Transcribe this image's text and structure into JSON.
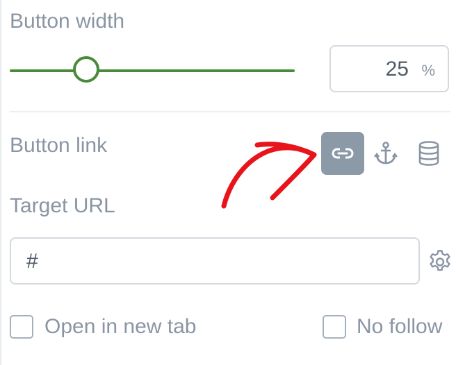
{
  "button_width": {
    "label": "Button width",
    "value": "25",
    "unit": "%",
    "slider_fraction": 0.25,
    "accent_color": "#4a8a3a"
  },
  "button_link": {
    "label": "Button link",
    "types": [
      {
        "icon": "link-icon",
        "active": true
      },
      {
        "icon": "anchor-icon",
        "active": false
      },
      {
        "icon": "database-icon",
        "active": false
      }
    ]
  },
  "target_url": {
    "label": "Target URL",
    "value": "#",
    "settings_icon": "gear-icon"
  },
  "options": {
    "open_new_tab": {
      "label": "Open in new tab",
      "checked": false
    },
    "no_follow": {
      "label": "No follow",
      "checked": false
    }
  },
  "annotation": {
    "arrow_color": "#e8141c"
  },
  "colors": {
    "label_text": "#8a95a3",
    "value_text": "#4f5b68",
    "border": "#d4d9df",
    "active_button": "#8c99a6"
  }
}
